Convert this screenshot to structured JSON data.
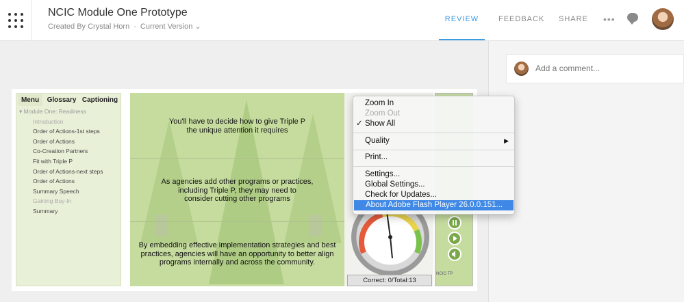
{
  "header": {
    "title": "NCIC Module One Prototype",
    "author": "Created By Crystal Horn",
    "separator": "·",
    "version": "Current Version",
    "version_chevron": "⌄",
    "nav": [
      "REVIEW",
      "FEEDBACK",
      "SHARE"
    ],
    "active_nav": "REVIEW",
    "more": "•••"
  },
  "comment": {
    "placeholder": "Add a comment..."
  },
  "player": {
    "tabs": [
      "Menu",
      "Glossary",
      "Captioning"
    ],
    "outline": [
      {
        "label": "Module One: Readiness",
        "level": 0
      },
      {
        "label": "Introduction",
        "level": 1,
        "visited": false
      },
      {
        "label": "Order of Actions-1st steps",
        "level": 1
      },
      {
        "label": "Order of Actions",
        "level": 1
      },
      {
        "label": "Co-Creation Partners",
        "level": 1
      },
      {
        "label": "Fit with Triple P",
        "level": 1
      },
      {
        "label": "Order of Actions-next steps",
        "level": 1
      },
      {
        "label": "Order of Actions",
        "level": 1
      },
      {
        "label": "Summary Speech",
        "level": 1
      },
      {
        "label": "Gaining Buy-In",
        "level": 1,
        "visited": false
      },
      {
        "label": "Summary",
        "level": 1
      }
    ],
    "captions": {
      "c1": "You'll have to decide how to give Triple P\nthe unique attention it requires",
      "c2": "As agencies add other programs or practices,\nincluding Triple P, they may need to\nconsider cutting other programs",
      "c3": "By embedding effective implementation strategies and best\npractices, agencies will have an opportunity to better align\nprograms internally and across the community."
    },
    "score": "Correct: 0/Total:13",
    "brand": "NCIC·TP"
  },
  "context_menu": {
    "items": [
      {
        "label": "Zoom In",
        "enabled": true
      },
      {
        "label": "Zoom Out",
        "enabled": false
      },
      {
        "label": "Show All",
        "checked": true
      },
      {
        "label": "Quality",
        "submenu": true
      },
      {
        "label": "Print..."
      },
      {
        "label": "Settings..."
      },
      {
        "label": "Global Settings..."
      },
      {
        "label": "Check for Updates..."
      },
      {
        "label": "About Adobe Flash Player 26.0.0.151...",
        "highlighted": true
      }
    ],
    "check_glyph": "✓",
    "submenu_glyph": "▶"
  },
  "colors": {
    "accent": "#3d9be2",
    "menu_highlight": "#3f88e5",
    "slide_bg": "#c6dc9f"
  }
}
